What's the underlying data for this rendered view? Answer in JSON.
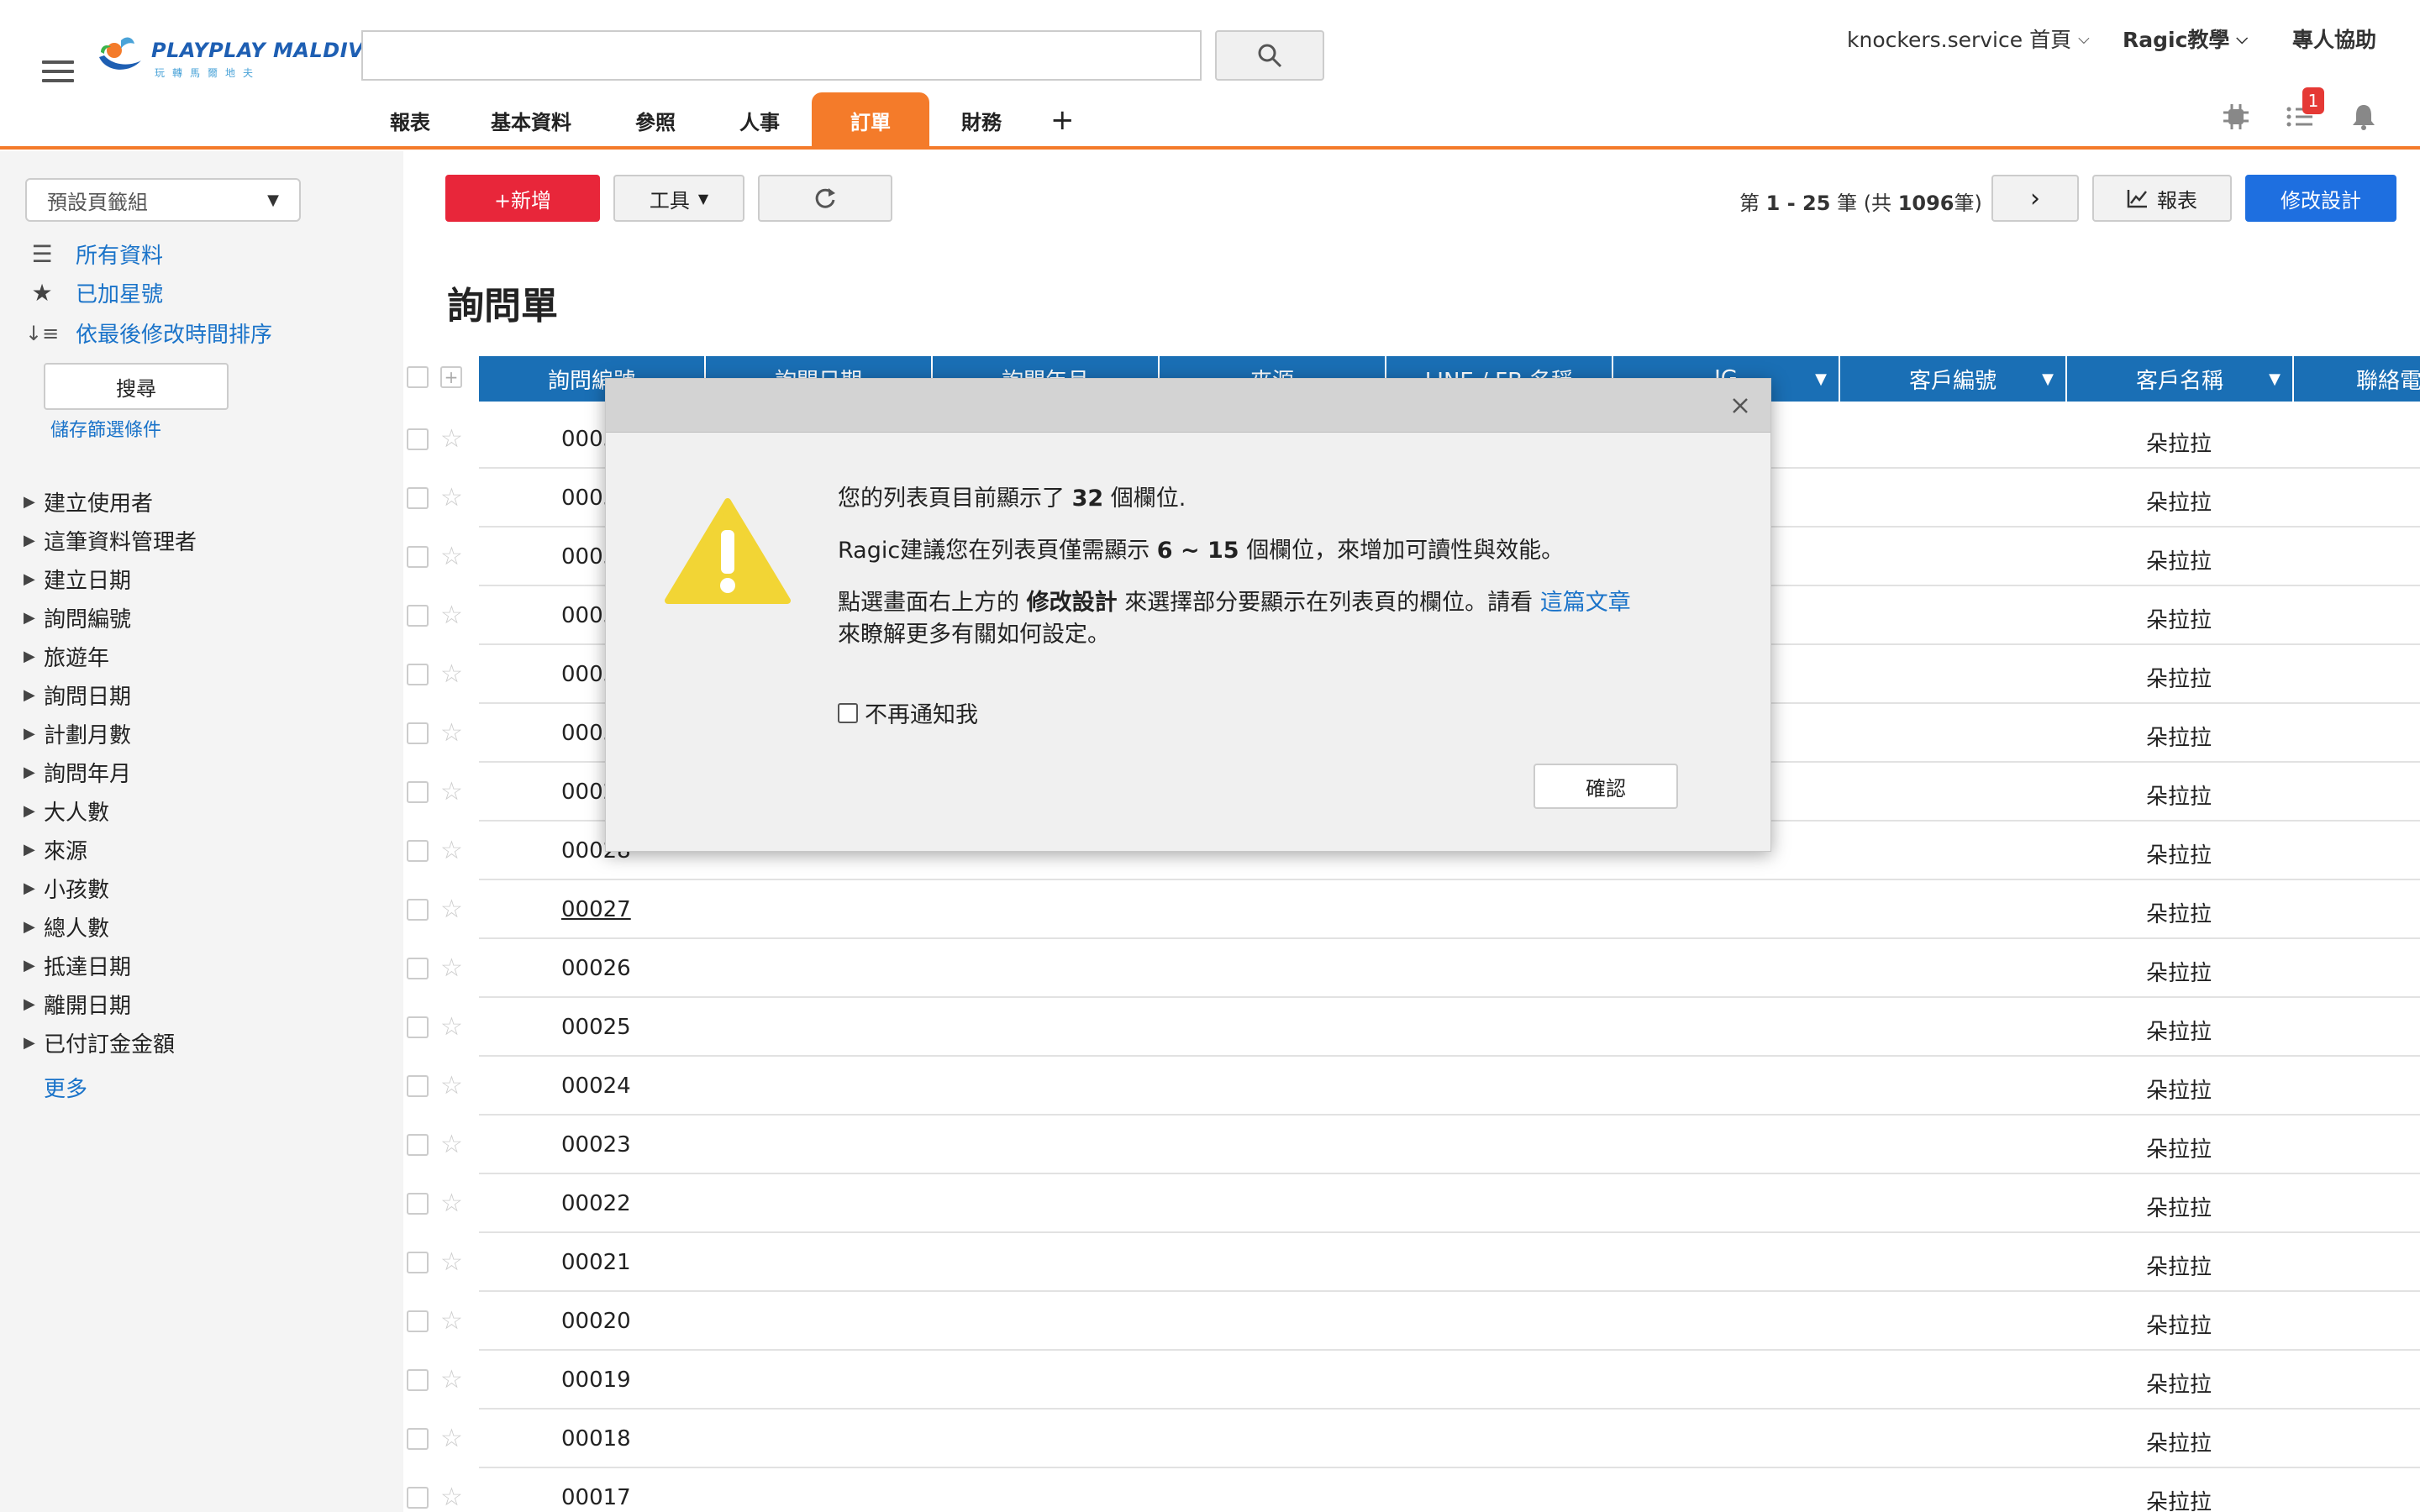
{
  "header": {
    "logo_text": "PLAYPLAY MALDIVES",
    "logo_sub": "玩轉馬爾地夫",
    "search": {
      "value": "",
      "placeholder": ""
    },
    "user_menu": "knockers.service 首頁",
    "tutorial_menu": "Ragic教學",
    "help_link": "專人協助",
    "notification_badge": "1",
    "tabs": [
      "報表",
      "基本資料",
      "參照",
      "人事",
      "訂單",
      "財務"
    ],
    "active_tab": "訂單",
    "add_tab": "+"
  },
  "sidebar": {
    "bookmark_group": "預設頁籤組",
    "links": [
      {
        "icon": "list-icon",
        "label": "所有資料"
      },
      {
        "icon": "star-icon",
        "label": "已加星號"
      },
      {
        "icon": "sort-icon",
        "label": "依最後修改時間排序"
      }
    ],
    "search_button": "搜尋",
    "save_filter": "儲存篩選條件",
    "filters": [
      "建立使用者",
      "這筆資料管理者",
      "建立日期",
      "詢問編號",
      "旅遊年",
      "詢問日期",
      "計劃月數",
      "詢問年月",
      "大人數",
      "來源",
      "小孩數",
      "總人數",
      "抵達日期",
      "離開日期",
      "已付訂金金額"
    ],
    "more": "更多"
  },
  "toolbar": {
    "new_label": "+新增",
    "tools_label": "工具",
    "pager_prefix": "第",
    "pager_range": "1 - 25",
    "pager_mid": "筆 (共",
    "pager_total": "1096",
    "pager_suffix": "筆)",
    "report_label": "報表",
    "design_label": "修改設計"
  },
  "page_title": "詢問單",
  "table": {
    "columns": [
      "詢問編號",
      "詢問日期",
      "詢問年月",
      "來源",
      "LINE / FB 名稱",
      "IG",
      "客戶編號",
      "客戶名稱",
      "聯絡電"
    ],
    "rows": [
      {
        "id": "00035",
        "customer": "朵拉拉"
      },
      {
        "id": "00034",
        "customer": "朵拉拉"
      },
      {
        "id": "00033",
        "customer": "朵拉拉"
      },
      {
        "id": "00032",
        "customer": "朵拉拉"
      },
      {
        "id": "00031",
        "customer": "朵拉拉"
      },
      {
        "id": "00030",
        "customer": "朵拉拉"
      },
      {
        "id": "00029",
        "customer": "朵拉拉"
      },
      {
        "id": "00028",
        "customer": "朵拉拉"
      },
      {
        "id": "00027",
        "customer": "朵拉拉"
      },
      {
        "id": "00026",
        "customer": "朵拉拉"
      },
      {
        "id": "00025",
        "customer": "朵拉拉"
      },
      {
        "id": "00024",
        "customer": "朵拉拉"
      },
      {
        "id": "00023",
        "customer": "朵拉拉"
      },
      {
        "id": "00022",
        "customer": "朵拉拉"
      },
      {
        "id": "00021",
        "customer": "朵拉拉"
      },
      {
        "id": "00020",
        "customer": "朵拉拉"
      },
      {
        "id": "00019",
        "customer": "朵拉拉"
      },
      {
        "id": "00018",
        "customer": "朵拉拉"
      },
      {
        "id": "00017",
        "customer": "朵拉拉"
      }
    ]
  },
  "modal": {
    "line1_pre": "您的列表頁目前顯示了",
    "line1_count": "32",
    "line1_post": "個欄位.",
    "line2_pre": "Ragic建議您在列表頁僅需顯示",
    "line2_range": "6 ~ 15",
    "line2_post": "個欄位，來增加可讀性與效能。",
    "line3_pre": "點選畫面右上方的",
    "line3_bold": "修改設計",
    "line3_mid": "來選擇部分要顯示在列表頁的欄位。請看",
    "line3_link": "這篇文章",
    "line3_post": "來瞭解更多有關如何設定。",
    "dont_show": "不再通知我",
    "confirm": "確認"
  },
  "colors": {
    "accent_orange": "#f47b2a",
    "new_red": "#e8263a",
    "design_blue": "#1e6fe0",
    "table_header_blue": "#1a6fb5",
    "link_blue": "#1a73c9",
    "warning_yellow": "#f2d535"
  }
}
